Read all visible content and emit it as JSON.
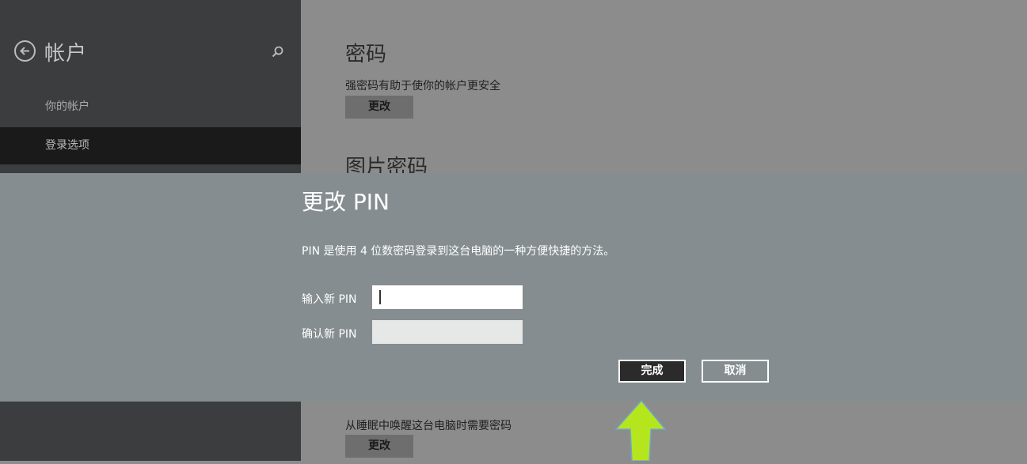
{
  "sidebar": {
    "title": "帐户",
    "items": [
      {
        "label": "你的帐户"
      },
      {
        "label": "登录选项"
      }
    ]
  },
  "main": {
    "password": {
      "title": "密码",
      "desc": "强密码有助于使你的帐户更安全",
      "button": "更改"
    },
    "picture_password": {
      "title": "图片密码"
    },
    "wake": {
      "desc": "从睡眠中唤醒这台电脑时需要密码",
      "button": "更改"
    }
  },
  "dialog": {
    "title": "更改 PIN",
    "desc": "PIN 是使用 4 位数密码登录到这台电脑的一种方便快捷的方法。",
    "new_pin_label": "输入新 PIN",
    "confirm_pin_label": "确认新 PIN",
    "new_pin_value": "",
    "confirm_pin_value": "",
    "done_button": "完成",
    "cancel_button": "取消"
  },
  "colors": {
    "sidebar_bg": "#3b3d3f",
    "sidebar_active": "#1a1a1a",
    "main_bg": "#8c8c8c",
    "dialog_bg": "#858d90",
    "arrow": "#b5e61d"
  },
  "icons": {
    "back": "back-arrow-circle-icon",
    "search": "search-icon",
    "pointer": "up-arrow-annotation-icon"
  }
}
